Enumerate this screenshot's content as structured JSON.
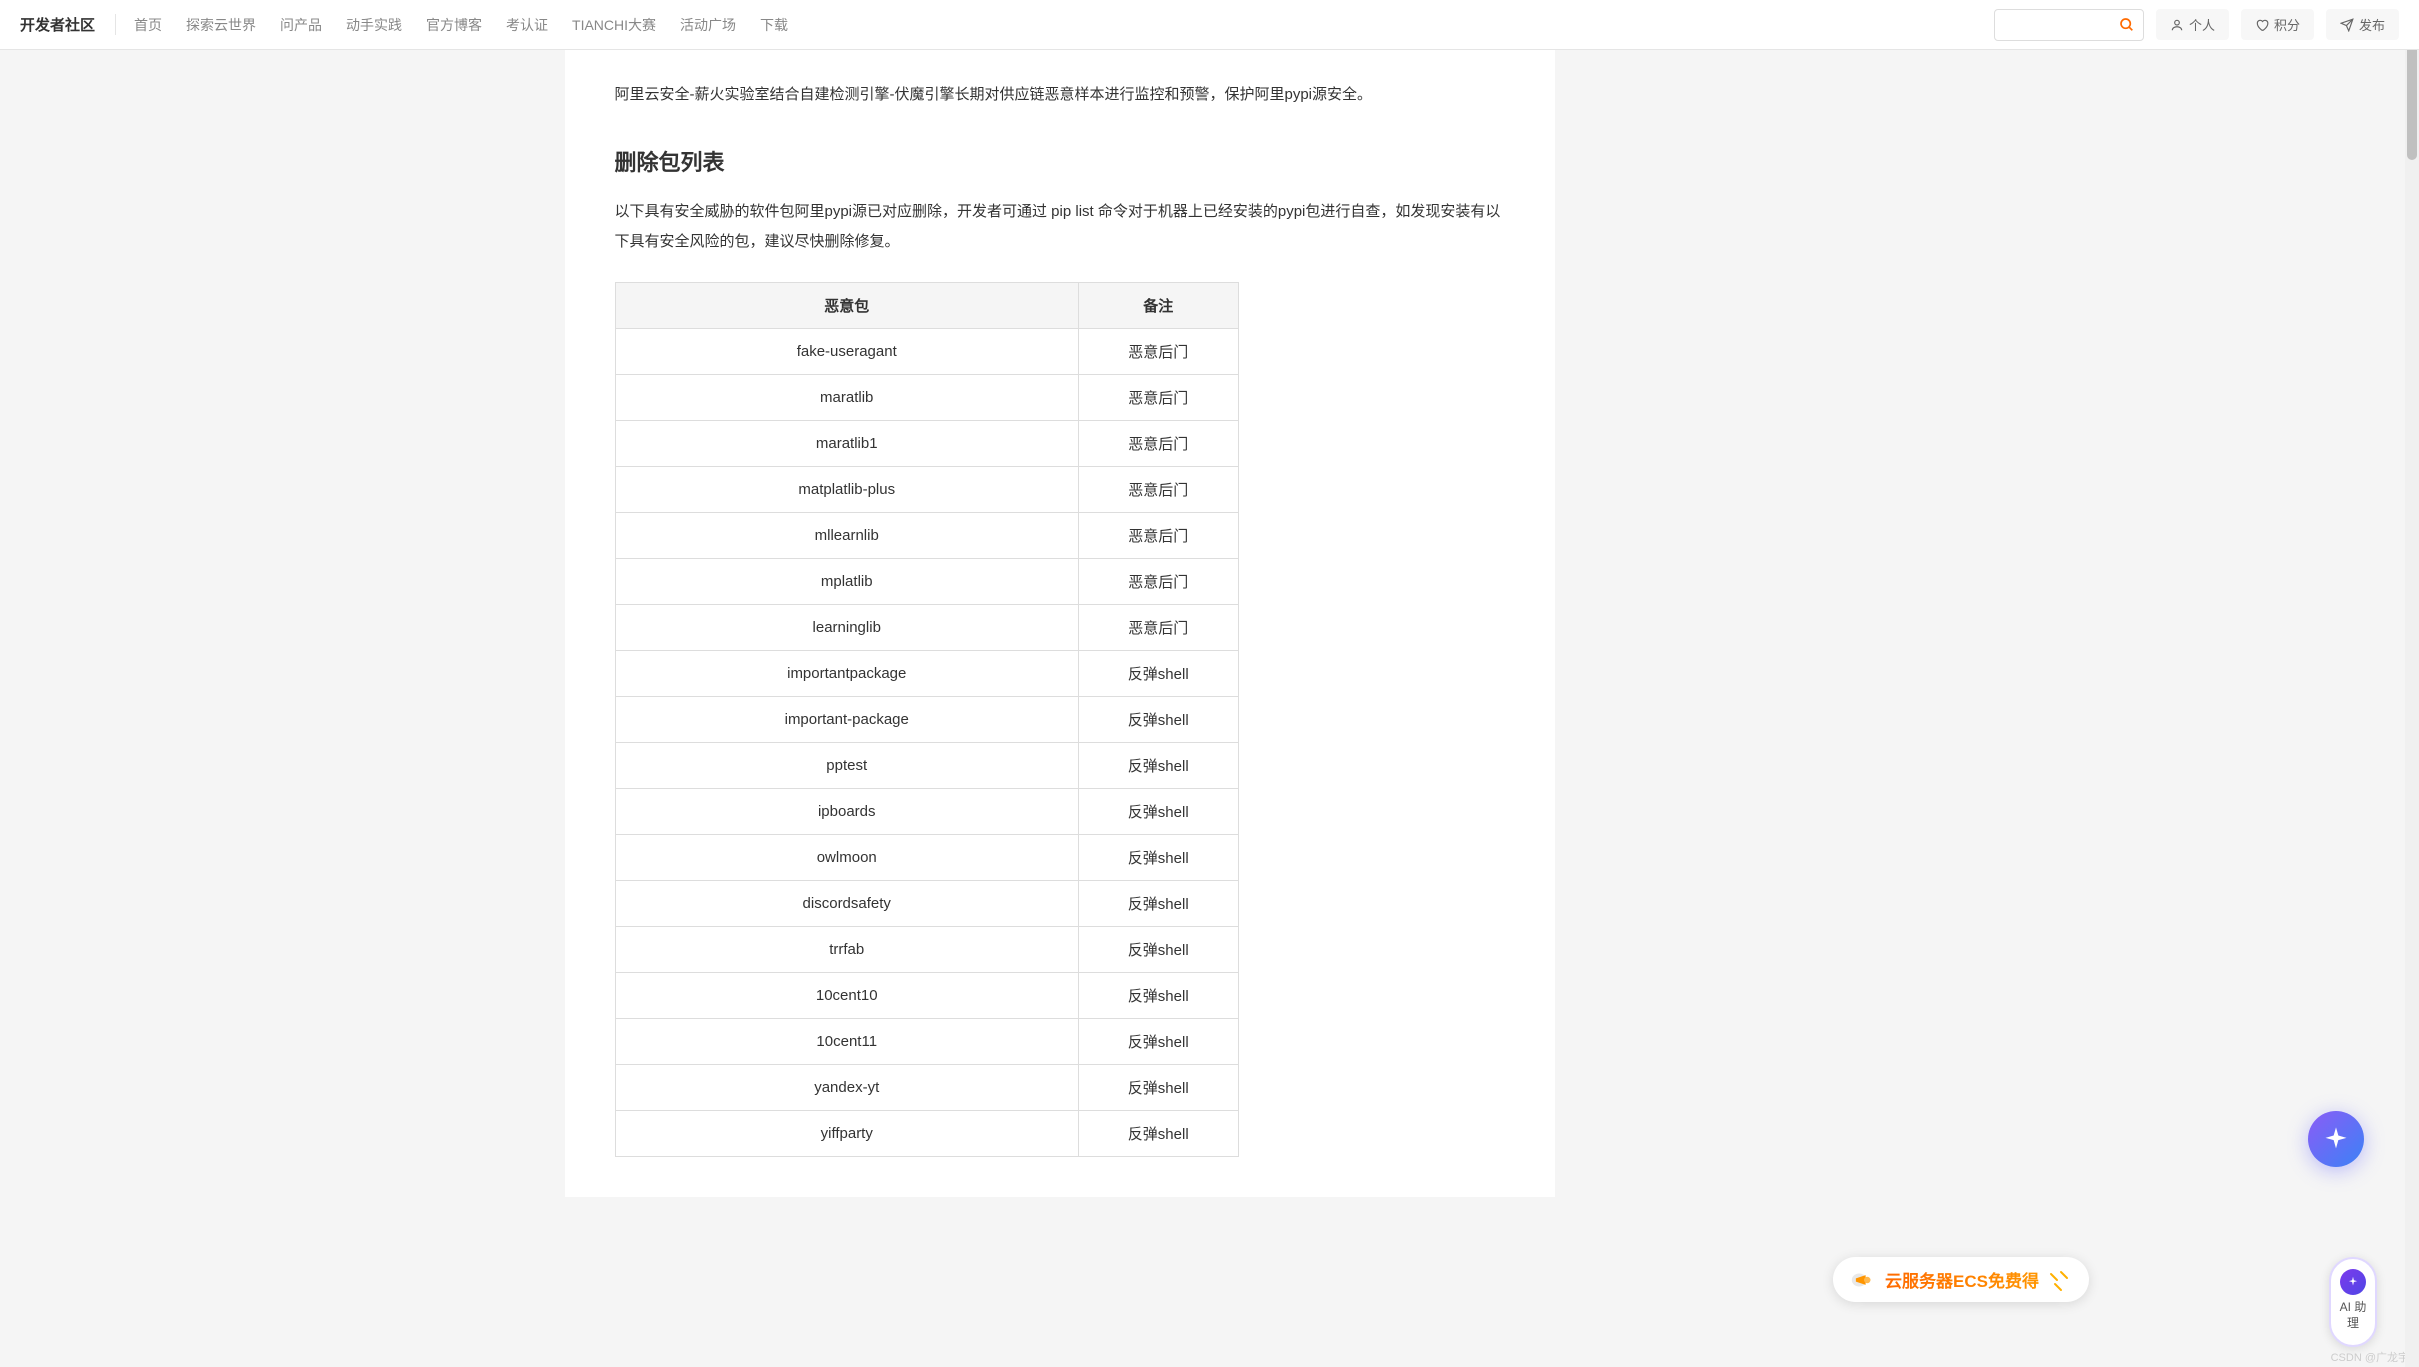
{
  "header": {
    "brand": "开发者社区",
    "nav": [
      "首页",
      "探索云世界",
      "问产品",
      "动手实践",
      "官方博客",
      "考认证",
      "TIANCHI大赛",
      "活动广场",
      "下载"
    ],
    "search_placeholder": "",
    "btn_personal": "个人",
    "btn_points": "积分",
    "btn_publish": "发布"
  },
  "article": {
    "intro": "阿里云安全-薪火实验室结合自建检测引擎-伏魔引擎长期对供应链恶意样本进行监控和预警，保护阿里pypi源安全。",
    "heading": "删除包列表",
    "desc": "以下具有安全威胁的软件包阿里pypi源已对应删除，开发者可通过 pip list 命令对于机器上已经安装的pypi包进行自查，如发现安装有以下具有安全风险的包，建议尽快删除修复。",
    "table_headers": [
      "恶意包",
      "备注"
    ],
    "rows": [
      {
        "pkg": "fake-useragant",
        "note": "恶意后门"
      },
      {
        "pkg": "maratlib",
        "note": "恶意后门"
      },
      {
        "pkg": "maratlib1",
        "note": "恶意后门"
      },
      {
        "pkg": "matplatlib-plus",
        "note": "恶意后门"
      },
      {
        "pkg": "mllearnlib",
        "note": "恶意后门"
      },
      {
        "pkg": "mplatlib",
        "note": "恶意后门"
      },
      {
        "pkg": "learninglib",
        "note": "恶意后门"
      },
      {
        "pkg": "importantpackage",
        "note": "反弹shell"
      },
      {
        "pkg": "important-package",
        "note": "反弹shell"
      },
      {
        "pkg": "pptest",
        "note": "反弹shell"
      },
      {
        "pkg": "ipboards",
        "note": "反弹shell"
      },
      {
        "pkg": "owlmoon",
        "note": "反弹shell"
      },
      {
        "pkg": "discordsafety",
        "note": "反弹shell"
      },
      {
        "pkg": "trrfab",
        "note": "反弹shell"
      },
      {
        "pkg": "10cent10",
        "note": "反弹shell"
      },
      {
        "pkg": "10cent11",
        "note": "反弹shell"
      },
      {
        "pkg": "yandex-yt",
        "note": "反弹shell"
      },
      {
        "pkg": "yiffparty",
        "note": "反弹shell"
      }
    ]
  },
  "float": {
    "ecs_text": "云服务器ECS免费得",
    "ai_label": "AI\n助\n理"
  },
  "watermark": "CSDN @广龙宇"
}
